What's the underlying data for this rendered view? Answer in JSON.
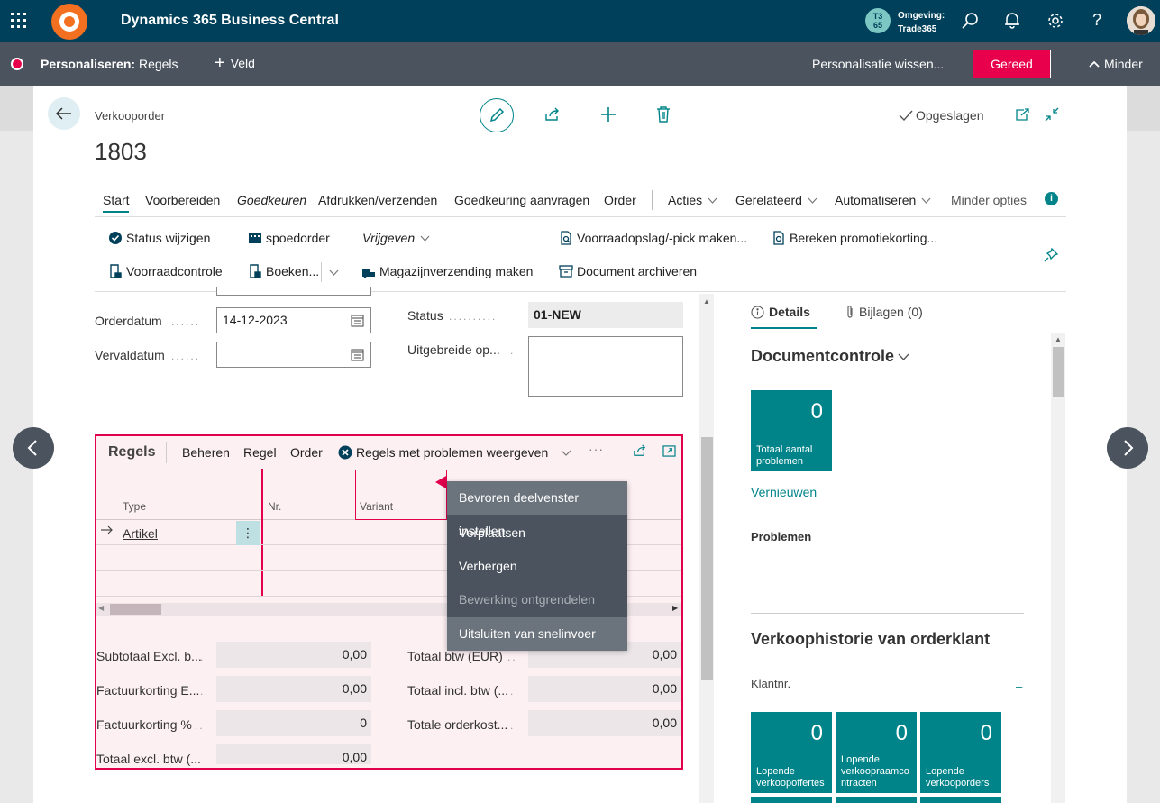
{
  "app": {
    "title": "Dynamics 365 Business Central",
    "env_label": "Omgeving:",
    "env_name": "Trade365",
    "env_badge_line1": "T3",
    "env_badge_line2": "65"
  },
  "personalize": {
    "label": "Personaliseren:",
    "target": "Regels",
    "add_field": "Veld",
    "clear": "Personalisatie wissen...",
    "done": "Gereed",
    "less": "Minder"
  },
  "page": {
    "caption": "Verkooporder",
    "number": "1803",
    "saved": "Opgeslagen"
  },
  "tabs": [
    "Start",
    "Voorbereiden",
    "Goedkeuren",
    "Afdrukken/verzenden",
    "Goedkeuring aanvragen",
    "Order",
    "Acties",
    "Gerelateerd",
    "Automatiseren",
    "Minder opties"
  ],
  "actions": {
    "status_wijzigen": "Status wijzigen",
    "spoedorder": "spoedorder",
    "vrijgeven": "Vrijgeven",
    "voorraadopslag": "Voorraadopslag/-pick maken...",
    "promotiekorting": "Bereken promotiekorting...",
    "voorraadcontrole": "Voorraadcontrole",
    "boeken": "Boeken...",
    "magazijn": "Magazijnverzending maken",
    "archiveren": "Document archiveren"
  },
  "fields": {
    "orderdatum_label": "Orderdatum",
    "orderdatum_value": "14-12-2023",
    "vervaldatum_label": "Vervaldatum",
    "vervaldatum_value": "",
    "status_label": "Status",
    "status_value": "01-NEW",
    "uitgebreide_label": "Uitgebreide op..."
  },
  "lines": {
    "title": "Regels",
    "menu": [
      "Beheren",
      "Regel",
      "Order"
    ],
    "problems": "Regels met problemen weergeven",
    "col_type": "Type",
    "col_nr": "Nr.",
    "col_variant": "Variant",
    "row1_type": "Artikel"
  },
  "context_menu": [
    "Bevroren deelvenster instellen",
    "Verplaatsen",
    "Verbergen",
    "Bewerking ontgrendelen",
    "Uitsluiten van snelinvoer"
  ],
  "totals": {
    "subtotaal_label": "Subtotaal Excl. b...",
    "subtotaal_value": "0,00",
    "factuurkorting_label": "Factuurkorting E...",
    "factuurkorting_value": "0,00",
    "factuurkorting_pct_label": "Factuurkorting %",
    "factuurkorting_pct_value": "0",
    "totaal_excl_label": "Totaal excl. btw (...",
    "totaal_excl_value": "0,00",
    "totaal_btw_label": "Totaal btw (EUR)",
    "totaal_btw_value": "0,00",
    "totaal_incl_label": "Totaal incl. btw (...",
    "totaal_incl_value": "0,00",
    "orderkost_label": "Totale orderkost...",
    "orderkost_value": "0,00"
  },
  "factbox": {
    "tab_details": "Details",
    "tab_bijlagen": "Bijlagen (0)",
    "doc_title": "Documentcontrole",
    "tile_value": "0",
    "tile_caption": "Totaal aantal problemen",
    "refresh": "Vernieuwen",
    "problems": "Problemen",
    "history_title": "Verkoophistorie van orderklant",
    "klantnr": "Klantnr.",
    "klantnr_value": "–",
    "tiles": [
      {
        "value": "0",
        "caption": "Lopende verkoopoffertes"
      },
      {
        "value": "0",
        "caption": "Lopende verkoopraamco ntracten"
      },
      {
        "value": "0",
        "caption": "Lopende verkooporders"
      }
    ]
  }
}
